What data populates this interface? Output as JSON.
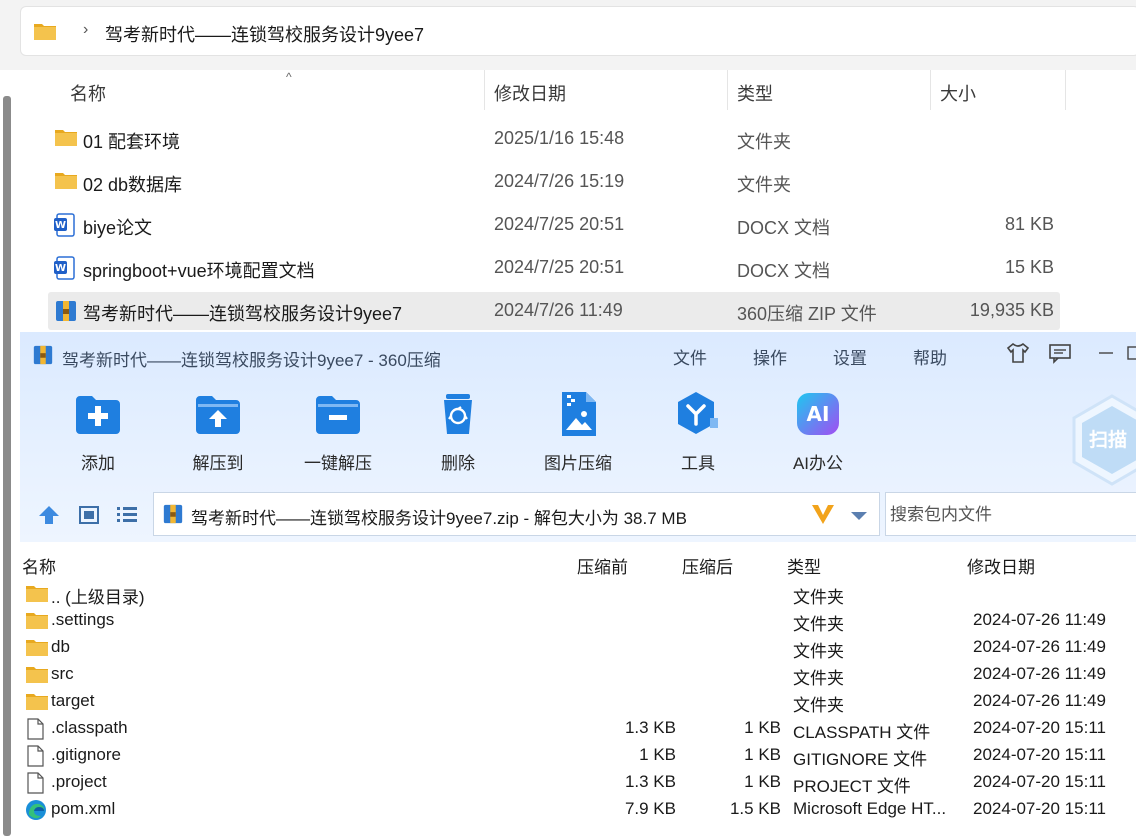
{
  "explorer": {
    "breadcrumb": "驾考新时代——连锁驾校服务设计9yee7",
    "breadcrumb_sep": "›",
    "sort_indicator": "^",
    "columns": {
      "name": "名称",
      "date": "修改日期",
      "type": "类型",
      "size": "大小"
    },
    "rows": [
      {
        "name": "01 配套环境",
        "date": "2025/1/16 15:48",
        "type": "文件夹",
        "size": "",
        "icon": "folder-icon"
      },
      {
        "name": "02 db数据库",
        "date": "2024/7/26 15:19",
        "type": "文件夹",
        "size": "",
        "icon": "folder-icon"
      },
      {
        "name": "biye论文",
        "date": "2024/7/25 20:51",
        "type": "DOCX 文档",
        "size": "81 KB",
        "icon": "word-icon"
      },
      {
        "name": "springboot+vue环境配置文档",
        "date": "2024/7/25 20:51",
        "type": "DOCX 文档",
        "size": "15 KB",
        "icon": "word-icon"
      },
      {
        "name": "驾考新时代——连锁驾校服务设计9yee7",
        "date": "2024/7/26 11:49",
        "type": "360压缩 ZIP 文件",
        "size": "19,935 KB",
        "icon": "zip-icon",
        "selected": true
      }
    ]
  },
  "zip": {
    "title": "驾考新时代——连锁驾校服务设计9yee7 - 360压缩",
    "menu": [
      "文件",
      "操作",
      "设置",
      "帮助"
    ],
    "toolbar": [
      "添加",
      "解压到",
      "一键解压",
      "删除",
      "图片压缩",
      "工具",
      "AI办公"
    ],
    "ai_badge": "AI",
    "scan_label": "扫描",
    "path_text": "驾考新时代——连锁驾校服务设计9yee7.zip - 解包大小为 38.7 MB",
    "search_placeholder": "搜索包内文件",
    "columns": {
      "name": "名称",
      "before": "压缩前",
      "after": "压缩后",
      "type": "类型",
      "date": "修改日期"
    },
    "rows": [
      {
        "name": ".. (上级目录)",
        "before": "",
        "after": "",
        "type": "文件夹",
        "date": "",
        "icon": "folder-icon"
      },
      {
        "name": ".settings",
        "before": "",
        "after": "",
        "type": "文件夹",
        "date": "2024-07-26 11:49",
        "icon": "folder-icon"
      },
      {
        "name": "db",
        "before": "",
        "after": "",
        "type": "文件夹",
        "date": "2024-07-26 11:49",
        "icon": "folder-icon"
      },
      {
        "name": "src",
        "before": "",
        "after": "",
        "type": "文件夹",
        "date": "2024-07-26 11:49",
        "icon": "folder-icon"
      },
      {
        "name": "target",
        "before": "",
        "after": "",
        "type": "文件夹",
        "date": "2024-07-26 11:49",
        "icon": "folder-icon"
      },
      {
        "name": ".classpath",
        "before": "1.3 KB",
        "after": "1 KB",
        "type": "CLASSPATH 文件",
        "date": "2024-07-20 15:11",
        "icon": "file-icon"
      },
      {
        "name": ".gitignore",
        "before": "1 KB",
        "after": "1 KB",
        "type": "GITIGNORE 文件",
        "date": "2024-07-20 15:11",
        "icon": "file-icon"
      },
      {
        "name": ".project",
        "before": "1.3 KB",
        "after": "1 KB",
        "type": "PROJECT 文件",
        "date": "2024-07-20 15:11",
        "icon": "file-icon"
      },
      {
        "name": "pom.xml",
        "before": "7.9 KB",
        "after": "1.5 KB",
        "type": "Microsoft Edge HT...",
        "date": "2024-07-20 15:11",
        "icon": "edge-icon"
      }
    ]
  },
  "colors": {
    "accent": "#1f7fe0",
    "folder": "#f4c34d",
    "selected_row": "#ebebeb",
    "toolbar_bg": "#dbeaff"
  }
}
